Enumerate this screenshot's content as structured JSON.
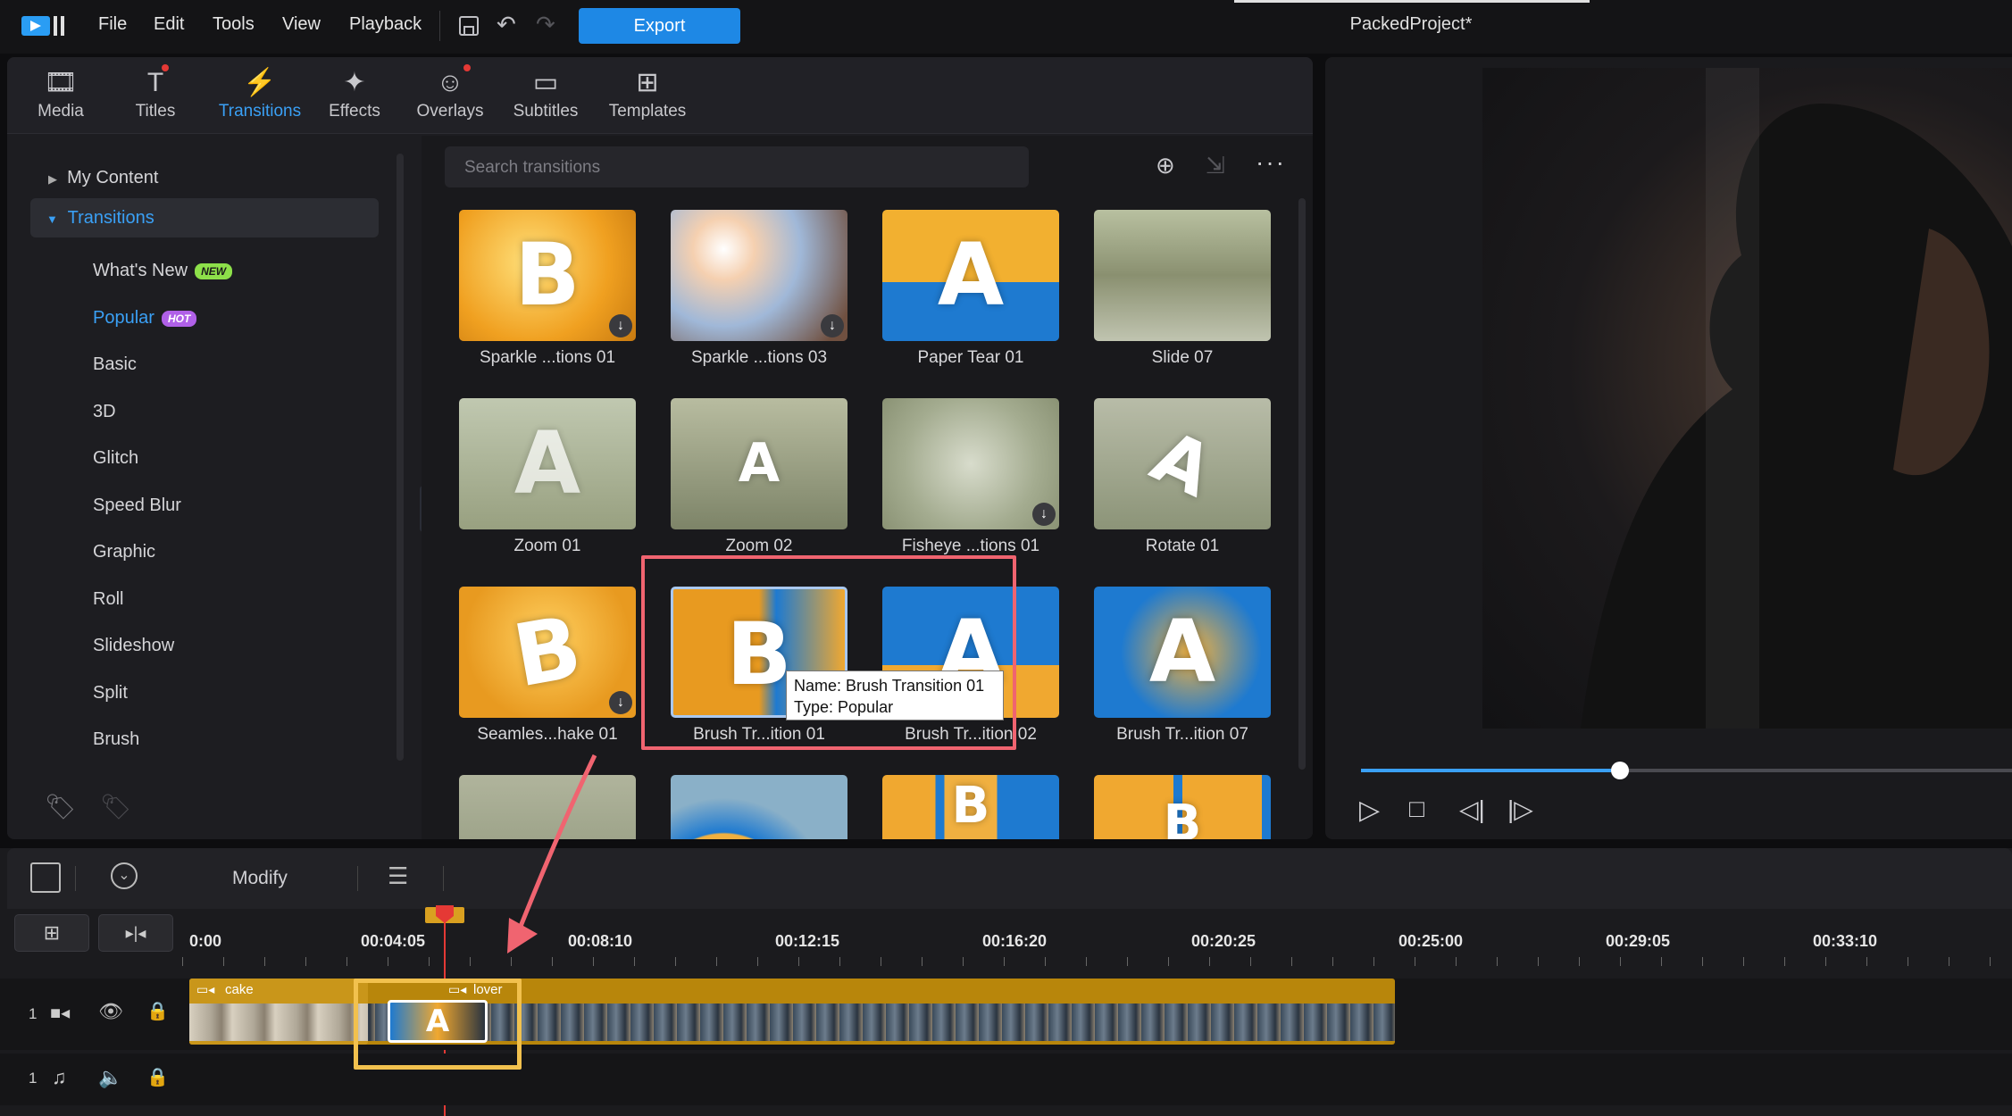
{
  "app": {
    "project_name": "PackedProject*",
    "export_label": "Export",
    "menu": [
      "File",
      "Edit",
      "Tools",
      "View",
      "Playback"
    ]
  },
  "tabs": [
    {
      "label": "Media",
      "icon": "media-icon"
    },
    {
      "label": "Titles",
      "icon": "titles-icon"
    },
    {
      "label": "Transitions",
      "icon": "transitions-icon"
    },
    {
      "label": "Effects",
      "icon": "effects-icon"
    },
    {
      "label": "Overlays",
      "icon": "overlays-icon"
    },
    {
      "label": "Subtitles",
      "icon": "subtitles-icon"
    },
    {
      "label": "Templates",
      "icon": "templates-icon"
    }
  ],
  "sidebar": {
    "my_content": "My Content",
    "transitions": "Transitions",
    "items": [
      "What's New",
      "Popular",
      "Basic",
      "3D",
      "Glitch",
      "Speed Blur",
      "Graphic",
      "Roll",
      "Slideshow",
      "Split",
      "Brush"
    ],
    "badge_new": "NEW",
    "badge_hot": "HOT"
  },
  "search": {
    "placeholder": "Search transitions"
  },
  "grid": {
    "items": [
      {
        "name": "Sparkle ...tions 01",
        "letter": "B"
      },
      {
        "name": "Sparkle ...tions 03",
        "letter": ""
      },
      {
        "name": "Paper Tear 01",
        "letter": "A"
      },
      {
        "name": "Slide 07",
        "letter": ""
      },
      {
        "name": "Zoom 01",
        "letter": "A"
      },
      {
        "name": "Zoom 02",
        "letter": "A"
      },
      {
        "name": "Fisheye ...tions 01",
        "letter": "A"
      },
      {
        "name": "Rotate 01",
        "letter": "A"
      },
      {
        "name": "Seamles...hake 01",
        "letter": "B"
      },
      {
        "name": "Brush Tr...ition 01",
        "letter": "B"
      },
      {
        "name": "Brush Tr...ition 02",
        "letter": "A"
      },
      {
        "name": "Brush Tr...ition 07",
        "letter": "A"
      },
      {
        "name": "",
        "letter": ""
      },
      {
        "name": "",
        "letter": ""
      },
      {
        "name": "",
        "letter": "B"
      },
      {
        "name": "",
        "letter": "B"
      }
    ],
    "tooltip": {
      "name_line": "Name: Brush Transition 01",
      "type_line": "Type: Popular"
    }
  },
  "timeline": {
    "modify_label": "Modify",
    "ticks": [
      "0:00",
      "00:04:05",
      "00:08:10",
      "00:12:15",
      "00:16:20",
      "00:20:25",
      "00:25:00",
      "00:29:05",
      "00:33:10"
    ],
    "track_video_num": "1",
    "track_audio_num": "1",
    "clip1": "cake",
    "clip2": "lover",
    "transition_letter": "A"
  },
  "colors": {
    "accent": "#1e88e5",
    "highlight_red": "#f06470",
    "highlight_yellow": "#f2c14e"
  }
}
